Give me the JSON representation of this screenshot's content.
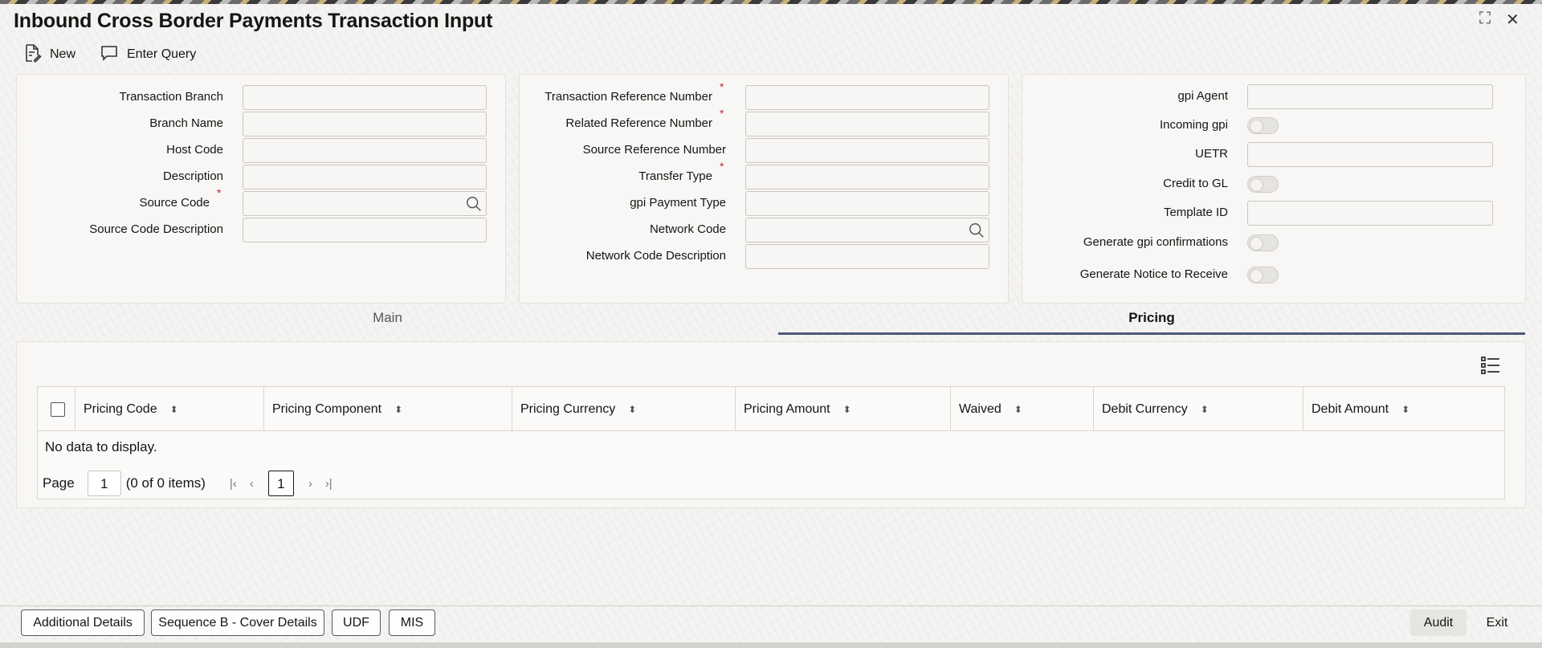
{
  "window": {
    "title": "Inbound Cross Border Payments Transaction Input",
    "restore_glyph": "⛶",
    "close_glyph": "✕"
  },
  "toolbar": {
    "new_label": "New",
    "enter_query_label": "Enter Query"
  },
  "panel_left": {
    "fields": [
      {
        "label": "Transaction Branch",
        "value": ""
      },
      {
        "label": "Branch Name",
        "value": ""
      },
      {
        "label": "Host Code",
        "value": ""
      },
      {
        "label": "Description",
        "value": ""
      },
      {
        "label": "Source Code",
        "value": "",
        "required": "*"
      },
      {
        "label": "Source Code Description",
        "value": ""
      }
    ]
  },
  "panel_middle": {
    "fields": [
      {
        "label": "Transaction Reference Number",
        "value": "",
        "required": "*"
      },
      {
        "label": "Related Reference Number",
        "value": "",
        "required": "*"
      },
      {
        "label": "Source Reference Number",
        "value": ""
      },
      {
        "label": "Transfer Type",
        "value": "",
        "required": "*"
      },
      {
        "label": "gpi Payment Type",
        "value": ""
      },
      {
        "label": "Network Code",
        "value": ""
      },
      {
        "label": "Network Code Description",
        "value": ""
      }
    ]
  },
  "panel_right": {
    "gpi_agent_label": "gpi Agent",
    "incoming_gpi_label": "Incoming gpi",
    "incoming_gpi_on": false,
    "uetr_label": "UETR",
    "credit_to_gl_label": "Credit to GL",
    "credit_to_gl_on": false,
    "template_id_label": "Template ID",
    "generate_gpi_conf_label": "Generate gpi confirmations",
    "generate_gpi_conf_on": false,
    "generate_notice_label": "Generate Notice to Receive",
    "generate_notice_on": false
  },
  "tabs": [
    {
      "label": "Main",
      "active": false
    },
    {
      "label": "Pricing",
      "active": true
    }
  ],
  "pricing_grid": {
    "columns": [
      "Pricing Code",
      "Pricing Component",
      "Pricing Currency",
      "Pricing Amount",
      "Waived",
      "Debit Currency",
      "Debit Amount"
    ],
    "sort_glyph": "⬍",
    "empty_text": "No data to display.",
    "pager": {
      "page_label": "Page",
      "page_value": "1",
      "items_text": "(0 of 0 items)",
      "current_page": "1",
      "first_glyph": "|‹",
      "prev_glyph": "‹",
      "next_glyph": "›",
      "last_glyph": "›|"
    }
  },
  "footer": {
    "additional_details": "Additional Details",
    "sequence_b": "Sequence B - Cover Details",
    "udf": "UDF",
    "mis": "MIS",
    "audit": "Audit",
    "exit": "Exit"
  }
}
